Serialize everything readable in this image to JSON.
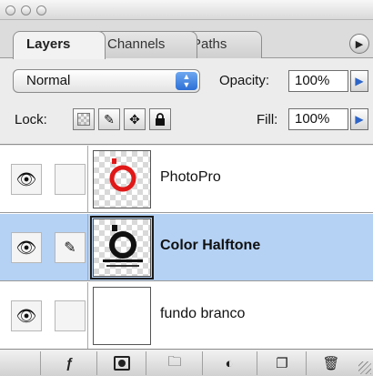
{
  "window": {
    "close_btn": "",
    "min_btn": "",
    "zoom_btn": ""
  },
  "tabs": [
    {
      "label": "Layers",
      "active": true
    },
    {
      "label": "Channels",
      "active": false
    },
    {
      "label": "Paths",
      "active": false
    }
  ],
  "panel_menu_icon": "triangle-right-icon",
  "options": {
    "blend_mode": "Normal",
    "opacity_label": "Opacity:",
    "opacity_value": "100%",
    "lock_label": "Lock:",
    "lock_icons": [
      "lock-transparent-pixels-icon",
      "lock-image-pixels-icon",
      "lock-position-icon",
      "lock-all-icon"
    ],
    "fill_label": "Fill:",
    "fill_value": "100%"
  },
  "layers": [
    {
      "name": "PhotoPro",
      "visible": true,
      "selected": false,
      "thumbnail": "red-ring-on-transparent"
    },
    {
      "name": "Color Halftone",
      "visible": true,
      "selected": true,
      "thumbnail": "black-halftone-ring"
    },
    {
      "name": "fundo branco",
      "visible": true,
      "selected": false,
      "thumbnail": "white-fill"
    }
  ],
  "bottom_toolbar": [
    "add-layer-style-icon",
    "add-layer-mask-icon",
    "new-layer-set-icon",
    "new-adjustment-layer-icon",
    "new-layer-icon",
    "delete-layer-icon"
  ],
  "colors": {
    "selection": "#b5d2f5",
    "accent_blue": "#2c6fd6",
    "ring_red": "#e01818"
  }
}
